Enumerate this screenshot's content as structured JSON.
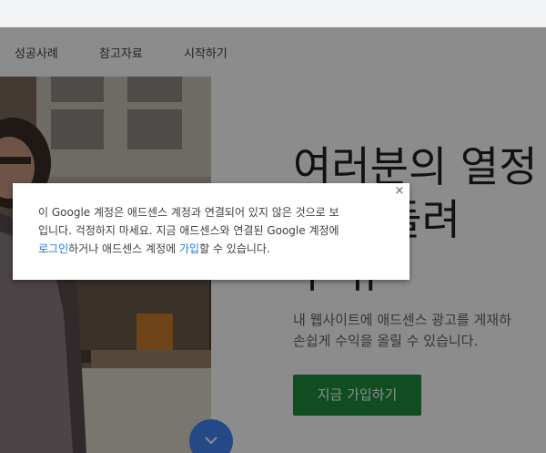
{
  "nav": {
    "items": [
      {
        "label": "성공사례"
      },
      {
        "label": "참고자료"
      },
      {
        "label": "시작하기"
      }
    ]
  },
  "hero": {
    "headline_lines": [
      "여러분의 열정",
      "으로 돌려",
      "수 뉴"
    ],
    "subtext_lines": [
      "내 웹사이트에 애드센스 광고를 게재하",
      "손쉽게 수익을 올릴 수 있습니다."
    ],
    "cta_label": "지금 가입하기",
    "cta_color": "#1e8e3e"
  },
  "dialog": {
    "line1": "이 Google 계정은 애드센스 계정과 연결되어 있지 않은 것으로 보",
    "line2": "입니다. 걱정하지 마세요. 지금 애드센스와 연결된 Google 계정에",
    "login_link": "로그인",
    "line3_mid": "하거나 애드센스 계정에 ",
    "signup_link": "가입",
    "line3_end": "할 수 있습니다.",
    "close_label": "×",
    "link_color": "#1a73e8"
  },
  "icons": {
    "close": "close-icon",
    "scroll": "chevron-down-icon"
  }
}
